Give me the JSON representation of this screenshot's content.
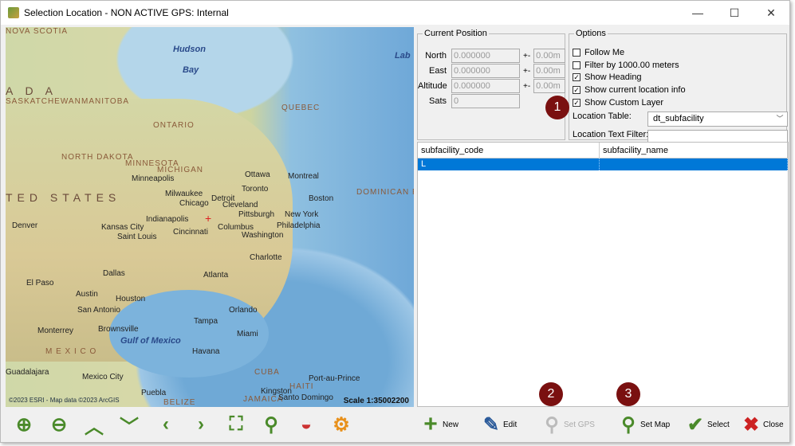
{
  "window": {
    "title": "Selection Location - NON ACTIVE GPS: Internal",
    "minimize": "—",
    "maximize": "☐",
    "close": "✕"
  },
  "map": {
    "labels": [
      {
        "t": "Hudson",
        "c": "ml-water"
      },
      {
        "t": "Bay",
        "c": "ml-water"
      },
      {
        "t": "Lab",
        "c": "ml-water"
      },
      {
        "t": "A   D   A",
        "c": "ml-ctry"
      },
      {
        "t": "SASKATCHEWAN",
        "c": "ml-cty"
      },
      {
        "t": "MANITOBA",
        "c": "ml-cty"
      },
      {
        "t": "ONTARIO",
        "c": "ml-cty"
      },
      {
        "t": "QUEBEC",
        "c": "ml-cty"
      },
      {
        "t": "NORTH DAKOTA",
        "c": "ml-cty"
      },
      {
        "t": "MINNESOTA",
        "c": "ml-cty"
      },
      {
        "t": "MICHIGAN",
        "c": "ml-cty"
      },
      {
        "t": "TED  STATES",
        "c": "ml-ctry"
      },
      {
        "t": "Minneapolis",
        "c": ""
      },
      {
        "t": "Ottawa",
        "c": ""
      },
      {
        "t": "Montreal",
        "c": ""
      },
      {
        "t": "Toronto",
        "c": ""
      },
      {
        "t": "Milwaukee",
        "c": ""
      },
      {
        "t": "Detroit",
        "c": ""
      },
      {
        "t": "Chicago",
        "c": ""
      },
      {
        "t": "Cleveland",
        "c": ""
      },
      {
        "t": "Boston",
        "c": ""
      },
      {
        "t": "Pittsburgh",
        "c": ""
      },
      {
        "t": "New York",
        "c": ""
      },
      {
        "t": "Indianapolis",
        "c": ""
      },
      {
        "t": "Columbus",
        "c": ""
      },
      {
        "t": "Philadelphia",
        "c": ""
      },
      {
        "t": "Denver",
        "c": ""
      },
      {
        "t": "Kansas City",
        "c": ""
      },
      {
        "t": "Saint Louis",
        "c": ""
      },
      {
        "t": "Cincinnati",
        "c": ""
      },
      {
        "t": "Washington",
        "c": ""
      },
      {
        "t": "Charlotte",
        "c": ""
      },
      {
        "t": "Dallas",
        "c": ""
      },
      {
        "t": "Atlanta",
        "c": ""
      },
      {
        "t": "El Paso",
        "c": ""
      },
      {
        "t": "Austin",
        "c": ""
      },
      {
        "t": "Houston",
        "c": ""
      },
      {
        "t": "San Antonio",
        "c": ""
      },
      {
        "t": "Orlando",
        "c": ""
      },
      {
        "t": "Tampa",
        "c": ""
      },
      {
        "t": "Miami",
        "c": ""
      },
      {
        "t": "Monterrey",
        "c": ""
      },
      {
        "t": "Brownsville",
        "c": ""
      },
      {
        "t": "Gulf of Mexico",
        "c": "ml-water"
      },
      {
        "t": "M E X I C O",
        "c": "ml-cty"
      },
      {
        "t": "Havana",
        "c": ""
      },
      {
        "t": "CUBA",
        "c": "ml-cty"
      },
      {
        "t": "Guadalajara",
        "c": ""
      },
      {
        "t": "Mexico City",
        "c": ""
      },
      {
        "t": "Puebla",
        "c": ""
      },
      {
        "t": "BELIZE",
        "c": "ml-cty"
      },
      {
        "t": "JAMAICA",
        "c": "ml-cty"
      },
      {
        "t": "Kingston",
        "c": ""
      },
      {
        "t": "HAITI",
        "c": "ml-cty"
      },
      {
        "t": "Santo Domingo",
        "c": ""
      },
      {
        "t": "Port-au-Prince",
        "c": ""
      },
      {
        "t": "DOMINICAN REPUBLIC",
        "c": "ml-cty"
      },
      {
        "t": "NOVA SCOTIA",
        "c": "ml-cty"
      }
    ],
    "copyright": "©2023 ESRI - Map data ©2023 ArcGIS",
    "scale": "Scale 1:35002200"
  },
  "position": {
    "legend": "Current Position",
    "rows": [
      {
        "label": "North",
        "value": "0.000000",
        "acc": "0.00m"
      },
      {
        "label": "East",
        "value": "0.000000",
        "acc": "0.00m"
      },
      {
        "label": "Altitude",
        "value": "0.000000",
        "acc": "0.00m"
      }
    ],
    "sats_label": "Sats",
    "sats_value": "0",
    "arrow": "+-"
  },
  "options": {
    "legend": "Options",
    "checks": [
      {
        "label": "Follow Me",
        "checked": false
      },
      {
        "label": "Filter by 1000.00 meters",
        "checked": false
      },
      {
        "label": "Show Heading",
        "checked": true
      },
      {
        "label": "Show current location info",
        "checked": true
      },
      {
        "label": "Show Custom Layer",
        "checked": true
      }
    ],
    "table_label": "Location Table:",
    "table_value": "dt_subfacility",
    "filter_label": "Location Text Filter:",
    "filter_value": ""
  },
  "grid": {
    "columns": [
      "subfacility_code",
      "subfacility_name"
    ],
    "rows": [
      [
        "L",
        ""
      ]
    ]
  },
  "badges": [
    "1",
    "2",
    "3"
  ],
  "toolbar": {
    "new": "New",
    "edit": "Edit",
    "set_gps": "Set GPS",
    "set_map": "Set Map",
    "select": "Select",
    "close": "Close"
  },
  "colors": {
    "selection": "#0078d7",
    "badge": "#7a1010",
    "icon_green": "#4a8a2a"
  }
}
